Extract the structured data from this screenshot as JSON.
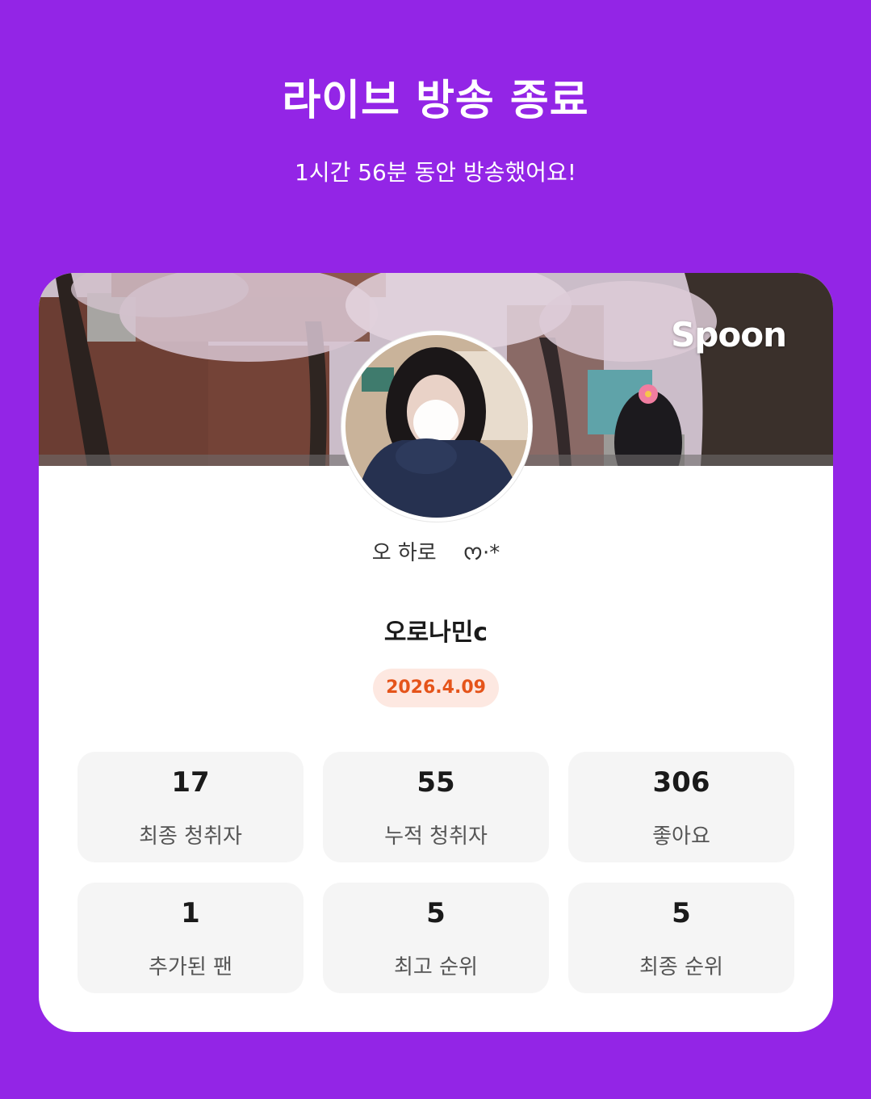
{
  "header": {
    "title": "라이브 방송 종료",
    "subtitle": "1시간 56분 동안 방송했어요!"
  },
  "card": {
    "brand_logo": "Spoon",
    "banner_image": "cherry-blossom-street-banner",
    "avatar_image": "profile-avatar-photo",
    "caption": "오 하로    ᰔ·*",
    "user_name": "오로나민c",
    "date": "2026.4.09",
    "stats": [
      {
        "value": "17",
        "label": "최종 청취자"
      },
      {
        "value": "55",
        "label": "누적 청취자"
      },
      {
        "value": "306",
        "label": "좋아요"
      },
      {
        "value": "1",
        "label": "추가된 팬"
      },
      {
        "value": "5",
        "label": "최고 순위"
      },
      {
        "value": "5",
        "label": "최종 순위"
      }
    ]
  },
  "colors": {
    "background": "#9325e6",
    "card": "#ffffff",
    "stat_box": "#f5f5f5",
    "date_badge_bg": "#fde8e1",
    "date_badge_text": "#e5541a"
  }
}
